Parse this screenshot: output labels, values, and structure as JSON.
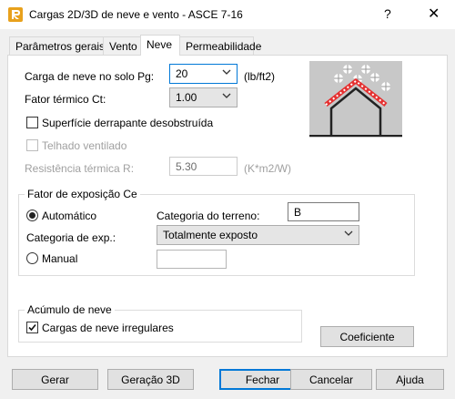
{
  "window": {
    "title": "Cargas 2D/3D de neve e vento - ASCE 7-16",
    "help_glyph": "?",
    "close_glyph": "✕"
  },
  "tabs": [
    {
      "label": "Parâmetros gerais"
    },
    {
      "label": "Vento"
    },
    {
      "label": "Neve"
    },
    {
      "label": "Permeabilidade"
    }
  ],
  "snow": {
    "ground_load_label": "Carga de neve no solo Pg:",
    "ground_load_value": "20",
    "ground_load_unit": "(lb/ft2)",
    "thermal_factor_label": "Fator térmico Ct:",
    "thermal_factor_value": "1.00",
    "slippery_surface_label": "Superfície derrapante desobstruída",
    "slippery_surface_checked": false,
    "ventilated_roof_label": "Telhado ventilado",
    "ventilated_roof_checked": false,
    "thermal_resistance_label": "Resistência térmica R:",
    "thermal_resistance_value": "5.30",
    "thermal_resistance_unit": "(K*m2/W)"
  },
  "exposure": {
    "group_title": "Fator de exposição Ce",
    "auto_label": "Automático",
    "auto_selected": true,
    "terrain_label": "Categoria do terreno:",
    "terrain_value": "B",
    "exp_category_label": "Categoria de exp.:",
    "exp_category_value": "Totalmente exposto",
    "manual_label": "Manual",
    "manual_value": ""
  },
  "drift": {
    "group_title": "Acúmulo de neve",
    "irregular_label": "Cargas de neve irregulares",
    "irregular_checked": true,
    "coef_button": "Coeficiente"
  },
  "footer": {
    "generate": "Gerar",
    "generate3d": "Geração 3D",
    "close": "Fechar",
    "cancel": "Cancelar",
    "help": "Ajuda"
  }
}
